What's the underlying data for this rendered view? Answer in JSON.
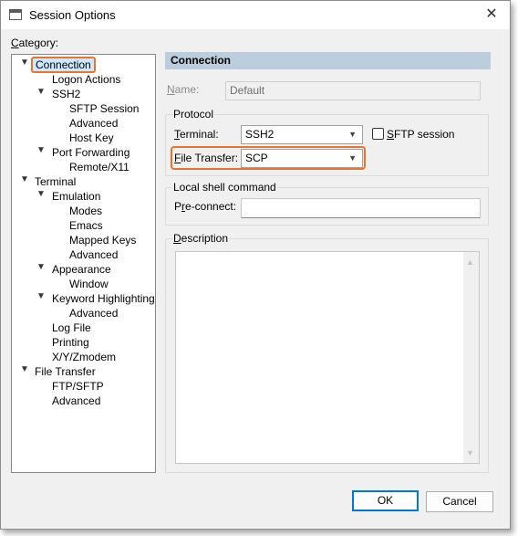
{
  "window": {
    "title": "Session Options"
  },
  "category": {
    "label_accel": "C",
    "label_rest": "ategory:",
    "tree": [
      {
        "label": "Connection",
        "toggle": "expanded",
        "selected": true
      },
      {
        "label": "Logon Actions"
      },
      {
        "label": "SSH2",
        "toggle": "expanded"
      },
      {
        "label": "SFTP Session"
      },
      {
        "label": "Advanced"
      },
      {
        "label": "Host Key"
      },
      {
        "label": "Port Forwarding",
        "toggle": "expanded"
      },
      {
        "label": "Remote/X11"
      },
      {
        "label": "Terminal",
        "toggle": "expanded"
      },
      {
        "label": "Emulation",
        "toggle": "expanded"
      },
      {
        "label": "Modes"
      },
      {
        "label": "Emacs"
      },
      {
        "label": "Mapped Keys"
      },
      {
        "label": "Advanced"
      },
      {
        "label": "Appearance",
        "toggle": "expanded"
      },
      {
        "label": "Window"
      },
      {
        "label": "Keyword Highlighting",
        "toggle": "expanded"
      },
      {
        "label": "Advanced"
      },
      {
        "label": "Log File"
      },
      {
        "label": "Printing"
      },
      {
        "label": "X/Y/Zmodem"
      },
      {
        "label": "File Transfer",
        "toggle": "expanded"
      },
      {
        "label": "FTP/SFTP"
      },
      {
        "label": "Advanced"
      }
    ]
  },
  "panel": {
    "header": "Connection",
    "name": {
      "label_accel": "N",
      "label_rest": "ame:",
      "value": "Default"
    },
    "protocol": {
      "group_title": "Protocol",
      "terminal": {
        "label_accel": "T",
        "label_rest": "erminal:",
        "value": "SSH2"
      },
      "sftp_session": {
        "label_accel": "S",
        "label_rest": "FTP session",
        "checked": false
      },
      "file_transfer": {
        "label_accel": "F",
        "label_rest": "ile Transfer:",
        "value": "SCP"
      }
    },
    "local_shell": {
      "group_title": "Local shell command",
      "preconnect": {
        "label_pre": "P",
        "label_accel": "r",
        "label_rest": "e-connect:",
        "value": ""
      }
    },
    "description": {
      "label_accel": "D",
      "label_rest": "escription",
      "value": ""
    }
  },
  "buttons": {
    "ok": "OK",
    "cancel": "Cancel"
  },
  "colors": {
    "highlight": "#e8752a",
    "header_bg": "#bccddd",
    "default_button_border": "#0078d7"
  }
}
